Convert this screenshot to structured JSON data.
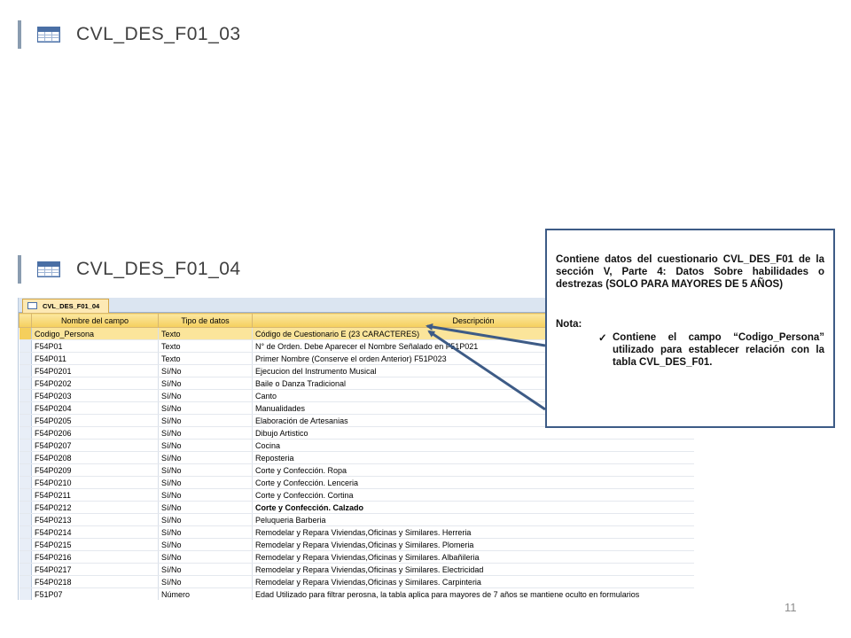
{
  "headers": {
    "top": "CVL_DES_F01_03",
    "bottom": "CVL_DES_F01_04"
  },
  "access": {
    "tab_label": "CVL_DES_F01_04",
    "columns": [
      "Nombre del campo",
      "Tipo de datos",
      "Descripción"
    ],
    "rows": [
      {
        "name": "Codigo_Persona",
        "type": "Texto",
        "desc": "Código de Cuestionario E (23 CARACTERES)"
      },
      {
        "name": "F54P01",
        "type": "Texto",
        "desc": "N° de Orden. Debe Aparecer el Nombre Señalado en F51P021"
      },
      {
        "name": "F54P011",
        "type": "Texto",
        "desc": "Primer Nombre (Conserve el orden Anterior) F51P023"
      },
      {
        "name": "F54P0201",
        "type": "Sí/No",
        "desc": "Ejecucion del Instrumento Musical"
      },
      {
        "name": "F54P0202",
        "type": "Sí/No",
        "desc": "Baile o Danza Tradicional"
      },
      {
        "name": "F54P0203",
        "type": "Sí/No",
        "desc": "Canto"
      },
      {
        "name": "F54P0204",
        "type": "Sí/No",
        "desc": "Manualidades"
      },
      {
        "name": "F54P0205",
        "type": "Sí/No",
        "desc": "Elaboración de Artesanias"
      },
      {
        "name": "F54P0206",
        "type": "Sí/No",
        "desc": "Dibujo Artistico"
      },
      {
        "name": "F54P0207",
        "type": "Sí/No",
        "desc": "Cocina"
      },
      {
        "name": "F54P0208",
        "type": "Sí/No",
        "desc": "Reposteria"
      },
      {
        "name": "F54P0209",
        "type": "Sí/No",
        "desc": "Corte y Confección. Ropa"
      },
      {
        "name": "F54P0210",
        "type": "Sí/No",
        "desc": "Corte y Confección. Lenceria"
      },
      {
        "name": "F54P0211",
        "type": "Sí/No",
        "desc": "Corte y Confección. Cortina"
      },
      {
        "name": "F54P0212",
        "type": "Sí/No",
        "desc": "Corte y Confección. Calzado"
      },
      {
        "name": "F54P0213",
        "type": "Sí/No",
        "desc": "Peluqueria Barberia"
      },
      {
        "name": "F54P0214",
        "type": "Sí/No",
        "desc": "Remodelar y Repara Viviendas,Oficinas y Similares. Herreria"
      },
      {
        "name": "F54P0215",
        "type": "Sí/No",
        "desc": "Remodelar y Repara Viviendas,Oficinas y Similares. Plomeria"
      },
      {
        "name": "F54P0216",
        "type": "Sí/No",
        "desc": "Remodelar y Repara Viviendas,Oficinas y Similares. Albañileria"
      },
      {
        "name": "F54P0217",
        "type": "Sí/No",
        "desc": "Remodelar y Repara Viviendas,Oficinas y Similares. Electricidad"
      },
      {
        "name": "F54P0218",
        "type": "Sí/No",
        "desc": "Remodelar y Repara Viviendas,Oficinas y Similares. Carpinteria"
      },
      {
        "name": "F51P07",
        "type": "Número",
        "desc": "Edad Utilizado para filtrar perosna, la tabla aplica para mayores de 7 años se mantiene oculto en formularios"
      }
    ]
  },
  "callout": {
    "description": "Contiene datos del cuestionario CVL_DES_F01 de la sección V, Parte 4: Datos Sobre habilidades o destrezas (SOLO PARA MAYORES DE 5 AÑOS)",
    "nota_label": "Nota:",
    "bullet_icon": "checkmark-icon",
    "bullet_text": "Contiene el campo “Codigo_Persona” utilizado para establecer relación con la tabla CVL_DES_F01."
  },
  "page_number": "11",
  "colors": {
    "callout_border": "#3d5b86",
    "header_bar": "#8a9cb0",
    "access_header": "#f5cf5c"
  }
}
